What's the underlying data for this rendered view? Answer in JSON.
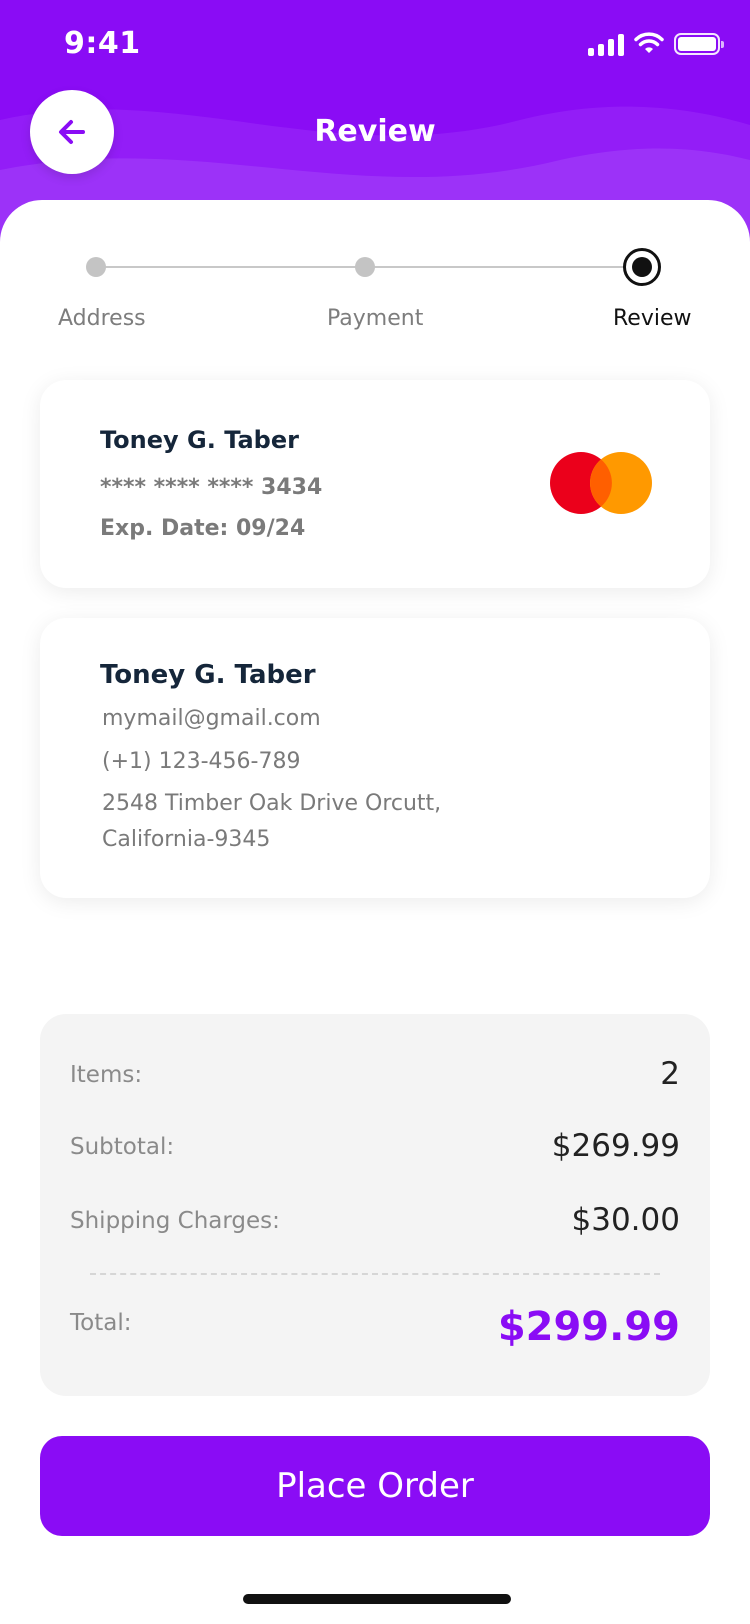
{
  "status_bar": {
    "time": "9:41"
  },
  "header": {
    "title": "Review",
    "back_icon": "arrow-left-icon"
  },
  "stepper": {
    "steps": [
      {
        "label": "Address",
        "state": "done"
      },
      {
        "label": "Payment",
        "state": "done"
      },
      {
        "label": "Review",
        "state": "active"
      }
    ]
  },
  "payment_card": {
    "name": "Toney G. Taber",
    "number": "**** **** **** 3434",
    "expiry": "Exp. Date: 09/24",
    "brand_icon": "mastercard-icon"
  },
  "address_card": {
    "name": "Toney G. Taber",
    "email": "mymail@gmail.com",
    "phone": "(+1) 123-456-789",
    "address_line1": "2548 Timber Oak Drive Orcutt,",
    "address_line2": "California-9345"
  },
  "summary": {
    "items_label": "Items:",
    "items_value": "2",
    "subtotal_label": "Subtotal:",
    "subtotal_value": "$269.99",
    "shipping_label": "Shipping Charges:",
    "shipping_value": "$30.00",
    "total_label": "Total:",
    "total_value": "$299.99"
  },
  "actions": {
    "place_order": "Place Order"
  },
  "colors": {
    "accent": "#8a0cf5",
    "mc_red": "#eb001b",
    "mc_orange": "#ff9900"
  }
}
